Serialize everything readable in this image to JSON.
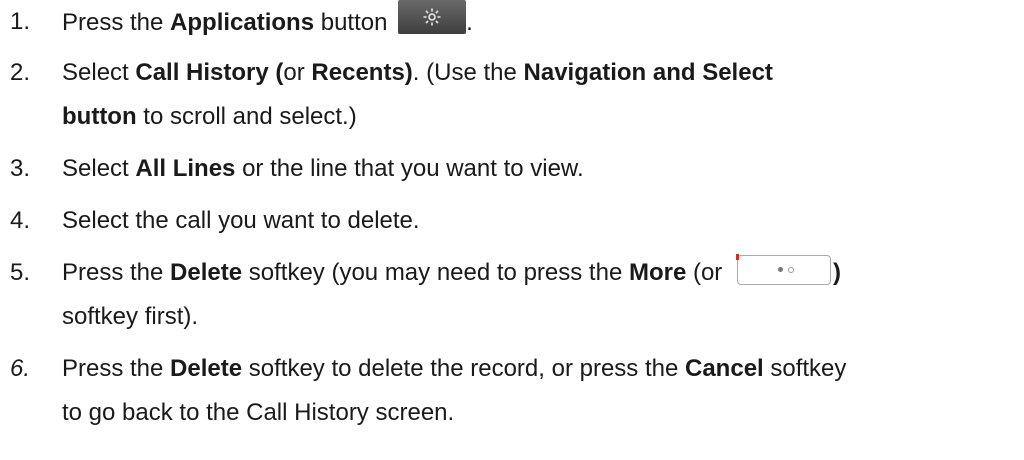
{
  "steps": [
    {
      "num": "1.",
      "p1": "Press the ",
      "b1": "Applications",
      "p2": " button ",
      "icon": "gear-icon",
      "p3": "."
    },
    {
      "num": "2.",
      "p1": "Select ",
      "b1": "Call History (",
      "p2": "or ",
      "b2": "Recents)",
      "p3": ". (Use the ",
      "b3": "Navigation and Select",
      "b4": "button",
      "p4": " to scroll and select.)"
    },
    {
      "num": "3.",
      "p1": "Select ",
      "b1": "All Lines",
      "p2": " or the line that you want to view."
    },
    {
      "num": "4.",
      "p1": "Select the call you want to delete."
    },
    {
      "num": "5.",
      "p1": "Press the ",
      "b1": "Delete",
      "p2": " softkey (you may need to press the ",
      "b2": "More",
      "p3": " (or ",
      "icon": "more-softkey-icon",
      "b3": ")",
      "p4": "softkey first)."
    },
    {
      "num": "6.",
      "p1": "Press the ",
      "b1": "Delete",
      "p2": " softkey to delete the record, or press the ",
      "b2": "Cancel",
      "p3": " softkey",
      "p4": "to go back to the Call History screen."
    }
  ]
}
